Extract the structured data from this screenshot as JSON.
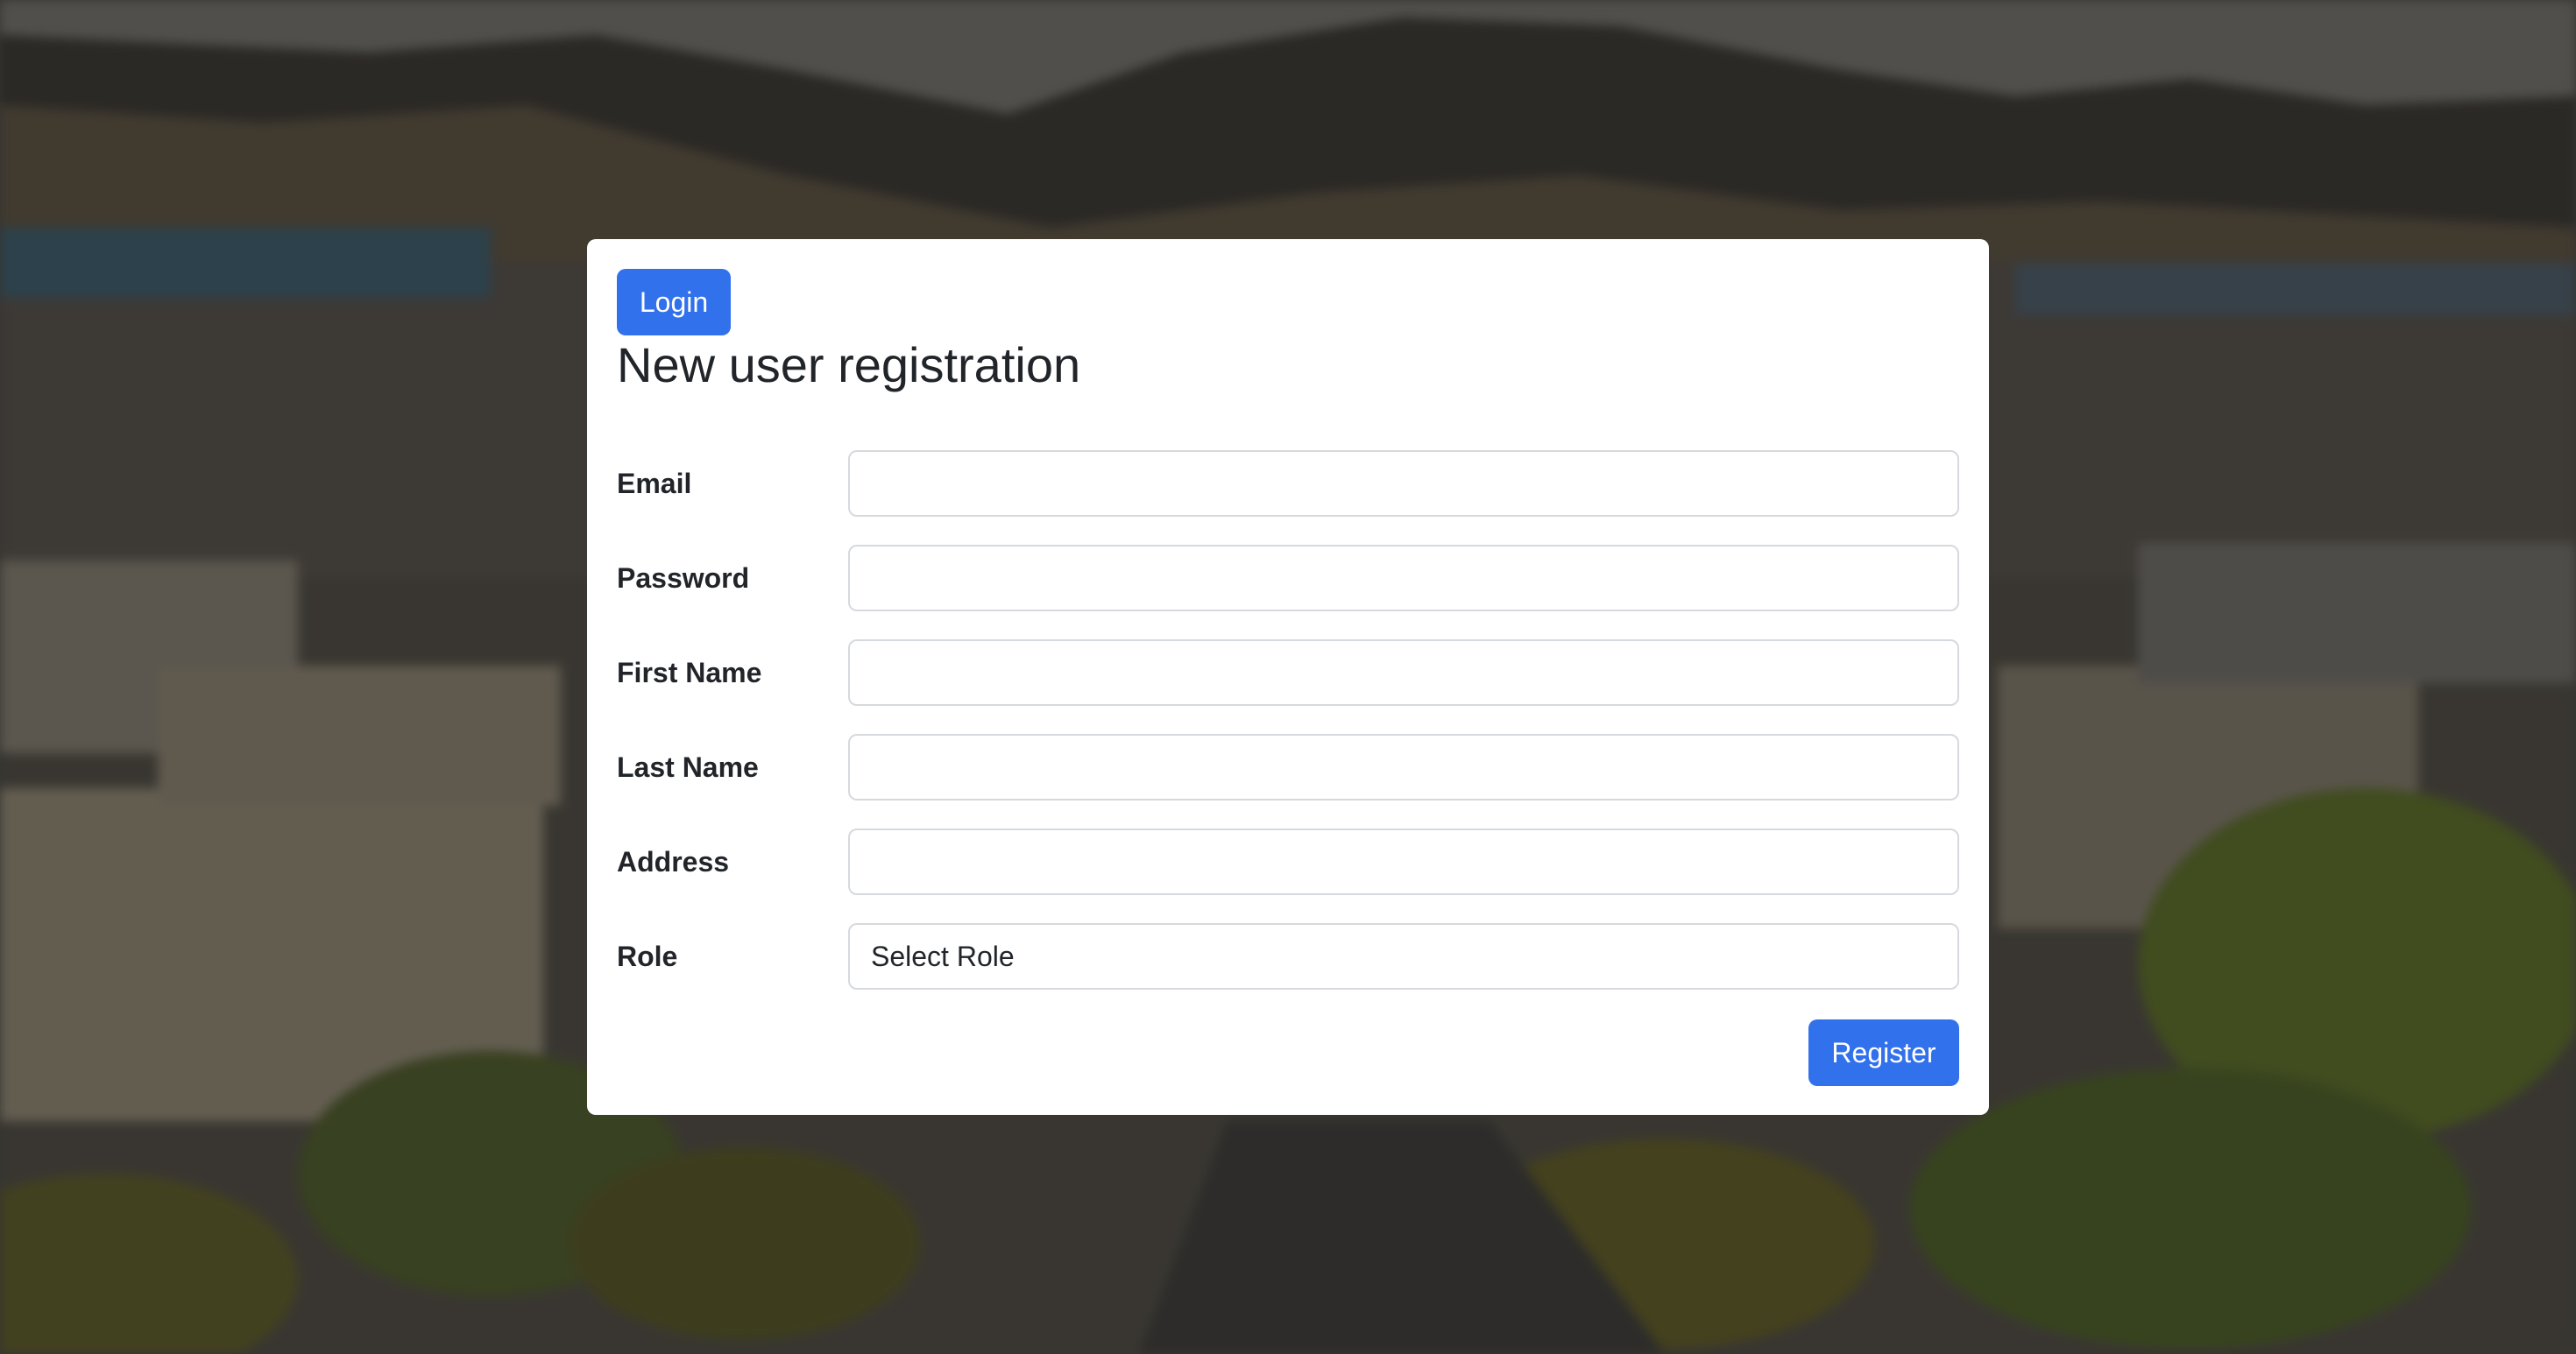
{
  "colors": {
    "primary": "#3271ec",
    "card_background": "#ffffff",
    "text": "#212529",
    "field_border": "#d6d9dd"
  },
  "nav": {
    "login_label": "Login"
  },
  "form": {
    "title": "New user registration",
    "fields": [
      {
        "label": "Email",
        "value": "",
        "type": "email"
      },
      {
        "label": "Password",
        "value": "",
        "type": "password"
      },
      {
        "label": "First Name",
        "value": "",
        "type": "text"
      },
      {
        "label": "Last Name",
        "value": "",
        "type": "text"
      },
      {
        "label": "Address",
        "value": "",
        "type": "text"
      }
    ],
    "role": {
      "label": "Role",
      "selected": "Select Role"
    },
    "register_label": "Register"
  },
  "background": {
    "icon": "campus-photo-blurred"
  }
}
